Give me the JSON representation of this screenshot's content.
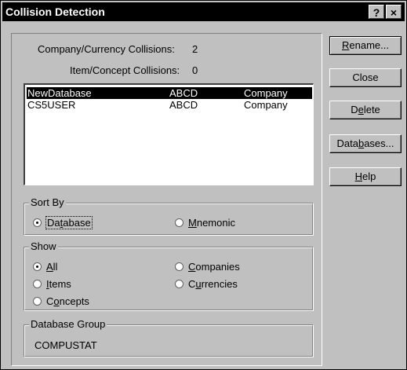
{
  "window": {
    "title": "Collision Detection",
    "help_glyph": "?",
    "close_glyph": "×"
  },
  "summary": {
    "company_currency_label": "Company/Currency Collisions:",
    "company_currency_count": "2",
    "item_concept_label": "Item/Concept Collisions:",
    "item_concept_count": "0"
  },
  "collisions": [
    {
      "database": "NewDatabase",
      "mnemonic": "ABCD",
      "type": "Company",
      "selected": true
    },
    {
      "database": "CS5USER",
      "mnemonic": "ABCD",
      "type": "Company",
      "selected": false
    }
  ],
  "sort_by": {
    "legend": "Sort By",
    "database_pre": "Da",
    "database_acc": "t",
    "database_post": "abase",
    "mnemonic_acc": "M",
    "mnemonic_post": "nemonic"
  },
  "show": {
    "legend": "Show",
    "all_acc": "A",
    "all_post": "ll",
    "items_acc": "I",
    "items_post": "tems",
    "concepts_pre": "C",
    "concepts_acc": "o",
    "concepts_post": "ncepts",
    "companies_acc": "C",
    "companies_post": "ompanies",
    "currencies_pre": "C",
    "currencies_acc": "u",
    "currencies_post": "rrencies"
  },
  "database_group": {
    "legend": "Database Group",
    "value": "COMPUSTAT"
  },
  "buttons": {
    "rename_acc": "R",
    "rename_post": "ename...",
    "close": "Close",
    "delete_pre": "D",
    "delete_acc": "e",
    "delete_post": "lete",
    "databases_pre": "Data",
    "databases_acc": "b",
    "databases_post": "ases...",
    "help_acc": "H",
    "help_post": "elp"
  }
}
